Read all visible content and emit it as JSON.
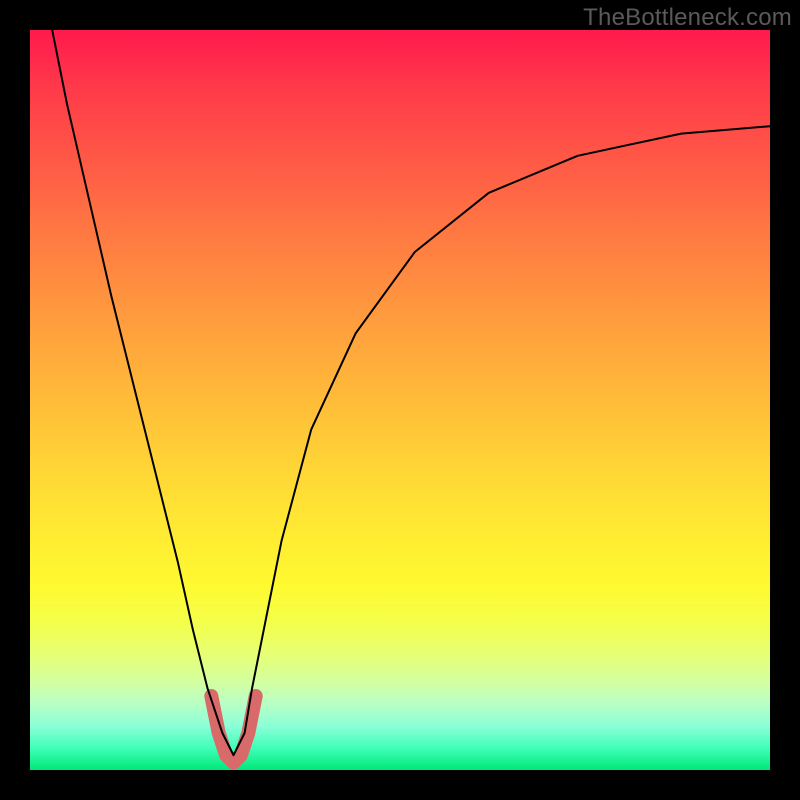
{
  "watermark": "TheBottleneck.com",
  "chart_data": {
    "type": "line",
    "title": "",
    "xlabel": "",
    "ylabel": "",
    "xlim": [
      0,
      100
    ],
    "ylim": [
      0,
      100
    ],
    "series": [
      {
        "name": "curve",
        "color": "#000000",
        "stroke_width": 2,
        "x": [
          3,
          5,
          8,
          11,
          14,
          17,
          20,
          22,
          24,
          26,
          27.5,
          29,
          30,
          32,
          34,
          38,
          44,
          52,
          62,
          74,
          88,
          100
        ],
        "y": [
          100,
          90,
          77,
          64,
          52,
          40,
          28,
          19,
          11,
          5,
          2,
          5,
          11,
          21,
          31,
          46,
          59,
          70,
          78,
          83,
          86,
          87
        ]
      },
      {
        "name": "highlight-v",
        "color": "#d86a6a",
        "stroke_width": 14,
        "x": [
          24.5,
          25.5,
          26.5,
          27.5,
          28.5,
          29.5,
          30.5
        ],
        "y": [
          10,
          5,
          2,
          1,
          2,
          5,
          10
        ]
      }
    ],
    "background_gradient": {
      "top": "#ff1a4d",
      "mid": "#ffe933",
      "bottom": "#00e878"
    }
  }
}
